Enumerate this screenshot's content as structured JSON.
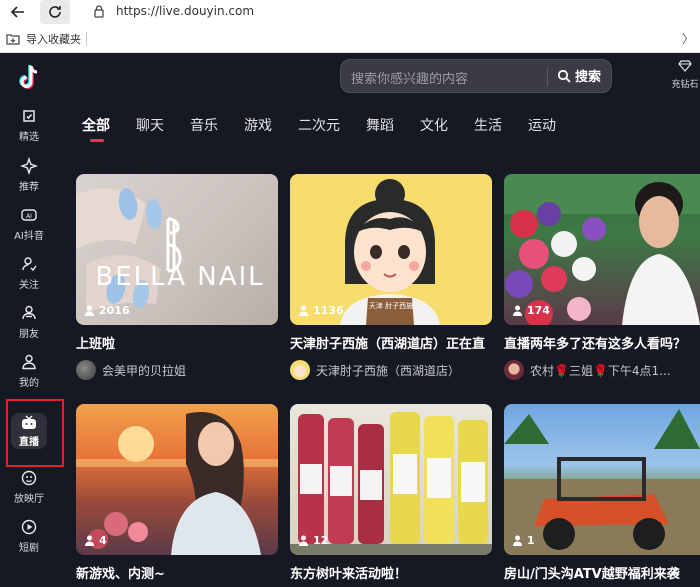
{
  "browser": {
    "url": "https://live.douyin.com",
    "bookmark": "导入收藏夹"
  },
  "search": {
    "placeholder": "搜索你感兴趣的内容",
    "button": "搜索"
  },
  "recharge_label": "充钻石",
  "sidebar": {
    "items": [
      {
        "label": "精选",
        "icon": "featured-icon"
      },
      {
        "label": "推荐",
        "icon": "sparkle-icon"
      },
      {
        "label": "AI抖音",
        "icon": "ai-icon"
      },
      {
        "label": "关注",
        "icon": "follow-icon"
      },
      {
        "label": "朋友",
        "icon": "friends-icon"
      },
      {
        "label": "我的",
        "icon": "profile-icon"
      },
      {
        "label": "直播",
        "icon": "tv-icon"
      },
      {
        "label": "放映厅",
        "icon": "theater-icon"
      },
      {
        "label": "短剧",
        "icon": "play-icon"
      }
    ]
  },
  "tabs": [
    "全部",
    "聊天",
    "音乐",
    "游戏",
    "二次元",
    "舞蹈",
    "文化",
    "生活",
    "运动"
  ],
  "cards": [
    {
      "viewers": "2016",
      "title": "上班啦",
      "author": "会美甲的贝拉姐",
      "logo_text": "BELLA NAIL"
    },
    {
      "viewers": "1136",
      "title": "天津肘子西施（西湖道店）正在直",
      "author": "天津肘子西施（西湖道店）",
      "apron_text": "天津 肘子西施"
    },
    {
      "viewers": "174",
      "title": "直播两年多了还有这多人看吗？",
      "author": "农村🌹三姐🌹下午4点1..."
    },
    {
      "viewers": "4",
      "title": "新游戏、内测~",
      "author": ""
    },
    {
      "viewers": "12",
      "title": "东方树叶来活动啦！",
      "author": ""
    },
    {
      "viewers": "1",
      "title": "房山/门头沟ATV越野福利来袭",
      "author": ""
    }
  ],
  "colors": {
    "bg": "#161823",
    "accent": "#fe2c55",
    "highlight": "#e8202e"
  }
}
